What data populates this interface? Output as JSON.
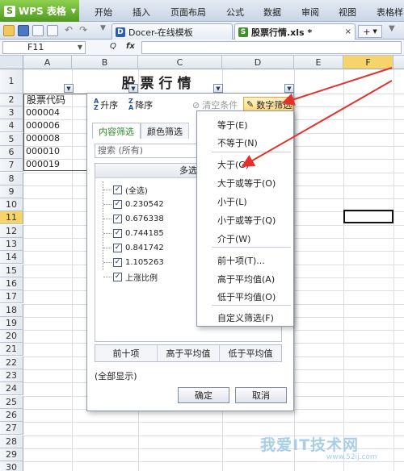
{
  "app": {
    "wps_label": "WPS 表格"
  },
  "menu": [
    "开始",
    "插入",
    "页面布局",
    "公式",
    "数据",
    "审阅",
    "视图",
    "表格样"
  ],
  "tabs": [
    {
      "label": "Docer-在线模板"
    },
    {
      "label": "股票行情.xls *"
    }
  ],
  "formula_bar": {
    "cell_ref": "F11",
    "zoom_glyph": "Q",
    "fx_glyph": "fx"
  },
  "columns": [
    "A",
    "B",
    "C",
    "D",
    "E",
    "F"
  ],
  "rows": [
    "1",
    "2",
    "3",
    "4",
    "5",
    "6",
    "7",
    "8",
    "9",
    "10",
    "11",
    "12",
    "13",
    "14",
    "15",
    "16",
    "17",
    "18",
    "19",
    "20",
    "21",
    "22",
    "23",
    "24",
    "25",
    "26",
    "27",
    "28",
    "29",
    "30"
  ],
  "sheet": {
    "title": "股票行情",
    "a2": "股票代码",
    "codes": [
      "000004",
      "000006",
      "000008",
      "000010",
      "000019"
    ]
  },
  "filter_dialog": {
    "sort_asc": "升序",
    "sort_desc": "降序",
    "clear": "清空条件",
    "number_filter": "数字筛选",
    "tab_content": "内容筛选",
    "tab_color": "颜色筛选",
    "search_placeholder": "搜索 (所有)",
    "list_header": "多选",
    "items": [
      "(全选)",
      "0.230542",
      "0.676338",
      "0.744185",
      "0.841742",
      "1.105263",
      "上涨比例"
    ],
    "btn_top10": "前十项",
    "btn_above": "高于平均值",
    "btn_below": "低于平均值",
    "show_all": "(全部显示)",
    "ok": "确定",
    "cancel": "取消"
  },
  "number_menu": {
    "items": [
      "等于(E)",
      "不等于(N)",
      "大于(G)",
      "大于或等于(O)",
      "小于(L)",
      "小于或等于(Q)",
      "介于(W)",
      "前十项(T)...",
      "高于平均值(A)",
      "低于平均值(O)",
      "自定义筛选(F)"
    ]
  },
  "watermark": {
    "text": "我爱IT技术网",
    "url": "www.52ij.com"
  },
  "colors": {
    "accent_green": "#4e9a1f",
    "arrow_red": "#e5312c",
    "selected_header": "#f6d46a"
  }
}
